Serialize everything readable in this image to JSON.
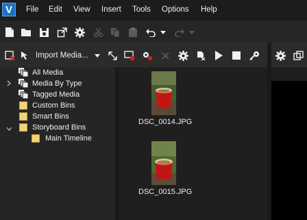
{
  "menu": {
    "items": [
      "File",
      "Edit",
      "View",
      "Insert",
      "Tools",
      "Options",
      "Help"
    ]
  },
  "app": {
    "logo_text": "V"
  },
  "panel_toolbar": {
    "import_label": "Import Media..."
  },
  "tree": {
    "items": [
      {
        "label": "All Media"
      },
      {
        "label": "Media By Type"
      },
      {
        "label": "Tagged Media"
      },
      {
        "label": "Custom Bins"
      },
      {
        "label": "Smart Bins"
      },
      {
        "label": "Storyboard Bins"
      },
      {
        "label": "Main Timeline"
      }
    ]
  },
  "media": {
    "items": [
      {
        "filename": "DSC_0014.JPG"
      },
      {
        "filename": "DSC_0015.JPG"
      }
    ]
  },
  "colors": {
    "accent": "#1a73c8",
    "bin_folder": "#f2d37a",
    "record_red": "#d02020",
    "cup_red": "#c41515"
  }
}
